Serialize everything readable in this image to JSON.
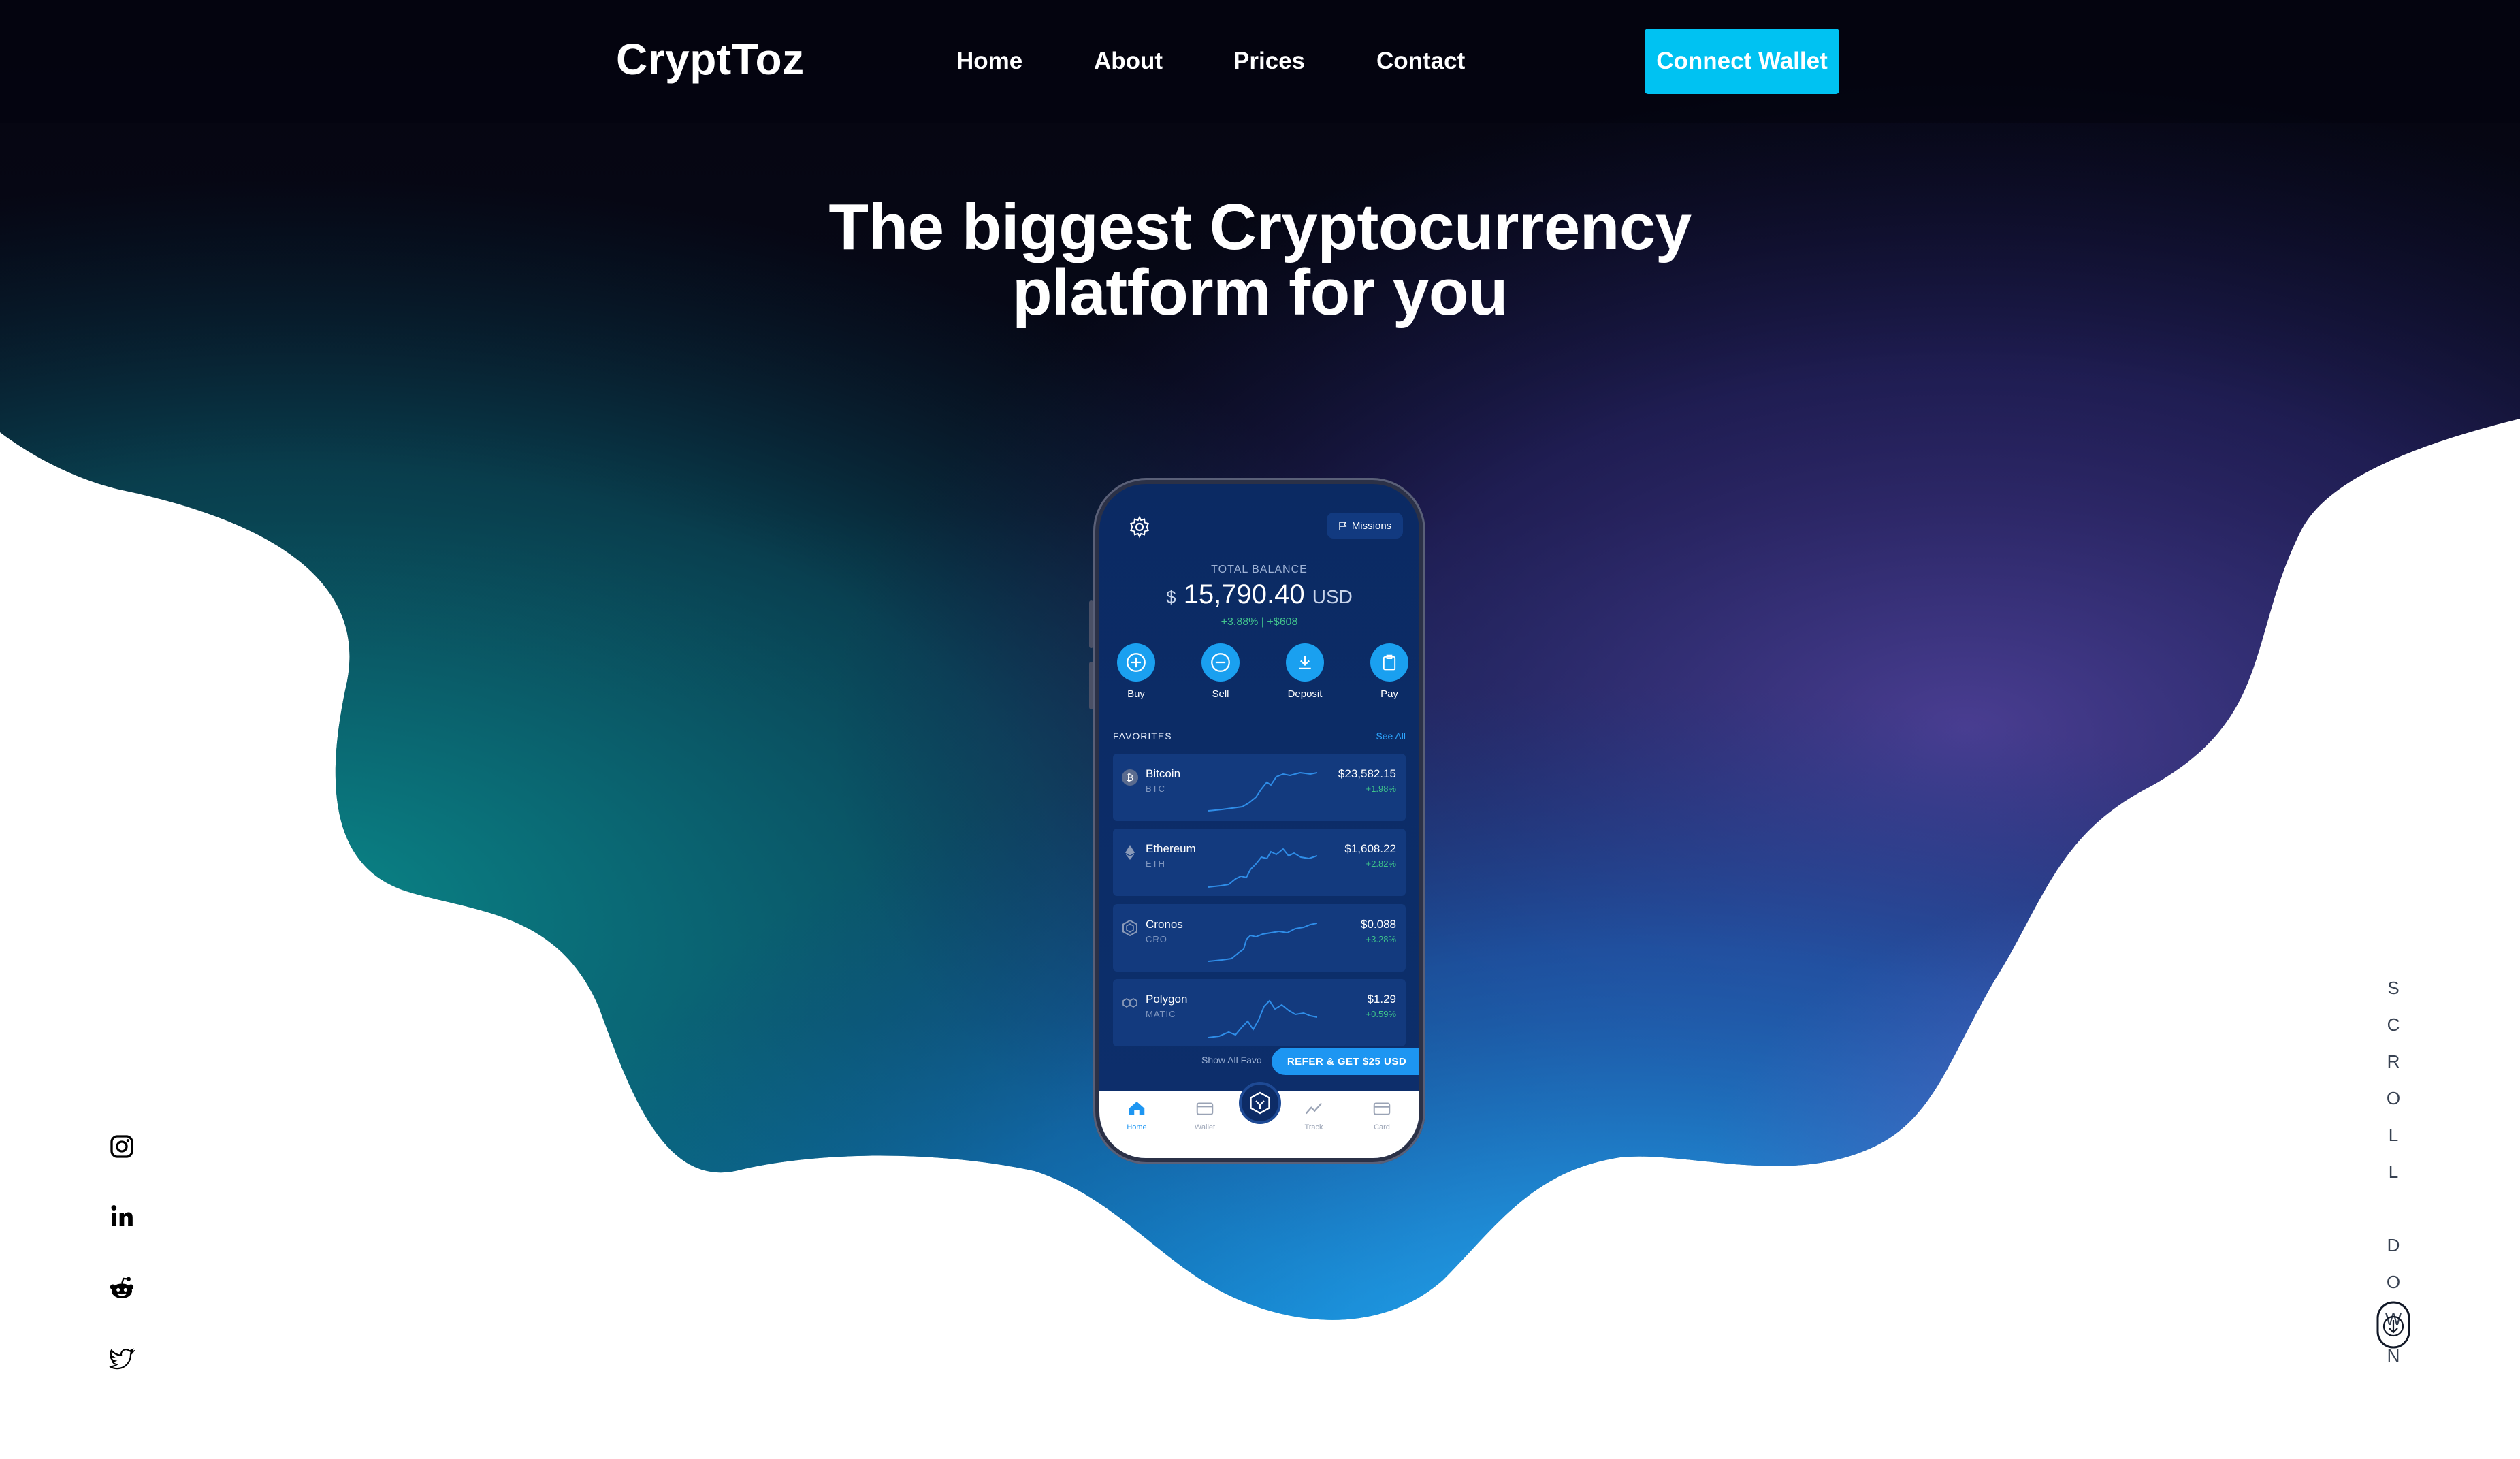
{
  "brand": {
    "name": "CryptToz"
  },
  "nav": {
    "items": [
      {
        "label": "Home"
      },
      {
        "label": "About"
      },
      {
        "label": "Prices"
      },
      {
        "label": "Contact"
      }
    ],
    "cta_label": "Connect Wallet"
  },
  "hero": {
    "headline_line1": "The biggest Cryptocurrency",
    "headline_line2": "platform for you"
  },
  "phone": {
    "missions_label": "Missions",
    "total_balance_label": "TOTAL BALANCE",
    "balance_currency_symbol": "$",
    "balance_value": "15,790.40",
    "balance_unit": "USD",
    "balance_change": "+3.88%  |  +$608",
    "actions": [
      {
        "label": "Buy",
        "icon": "plus-circle-icon"
      },
      {
        "label": "Sell",
        "icon": "minus-circle-icon"
      },
      {
        "label": "Deposit",
        "icon": "download-icon"
      },
      {
        "label": "Pay",
        "icon": "clipboard-icon"
      }
    ],
    "favorites_title": "FAVORITES",
    "see_all": "See All",
    "coins": [
      {
        "name": "Bitcoin",
        "symbol": "BTC",
        "price": "$23,582.15",
        "change": "+1.98%"
      },
      {
        "name": "Ethereum",
        "symbol": "ETH",
        "price": "$1,608.22",
        "change": "+2.82%"
      },
      {
        "name": "Cronos",
        "symbol": "CRO",
        "price": "$0.088",
        "change": "+3.28%"
      },
      {
        "name": "Polygon",
        "symbol": "MATIC",
        "price": "$1.29",
        "change": "+0.59%"
      }
    ],
    "show_all": "Show All Favo",
    "refer_label": "REFER & GET $25 USD",
    "tabs": [
      {
        "label": "Home",
        "icon": "home-icon"
      },
      {
        "label": "Wallet",
        "icon": "wallet-icon"
      },
      {
        "label": "Track",
        "icon": "chart-line-icon"
      },
      {
        "label": "Card",
        "icon": "card-icon"
      }
    ]
  },
  "social": [
    "instagram-icon",
    "linkedin-icon",
    "reddit-icon",
    "twitter-icon"
  ],
  "scroll": {
    "label": "SCROLL DOWN"
  },
  "colors": {
    "accent": "#00c2f2",
    "hero_dark": "#05060f",
    "hero_teal": "#0a8a96",
    "hero_purple": "#4a3e8f",
    "hero_blue": "#1fa4e8"
  }
}
